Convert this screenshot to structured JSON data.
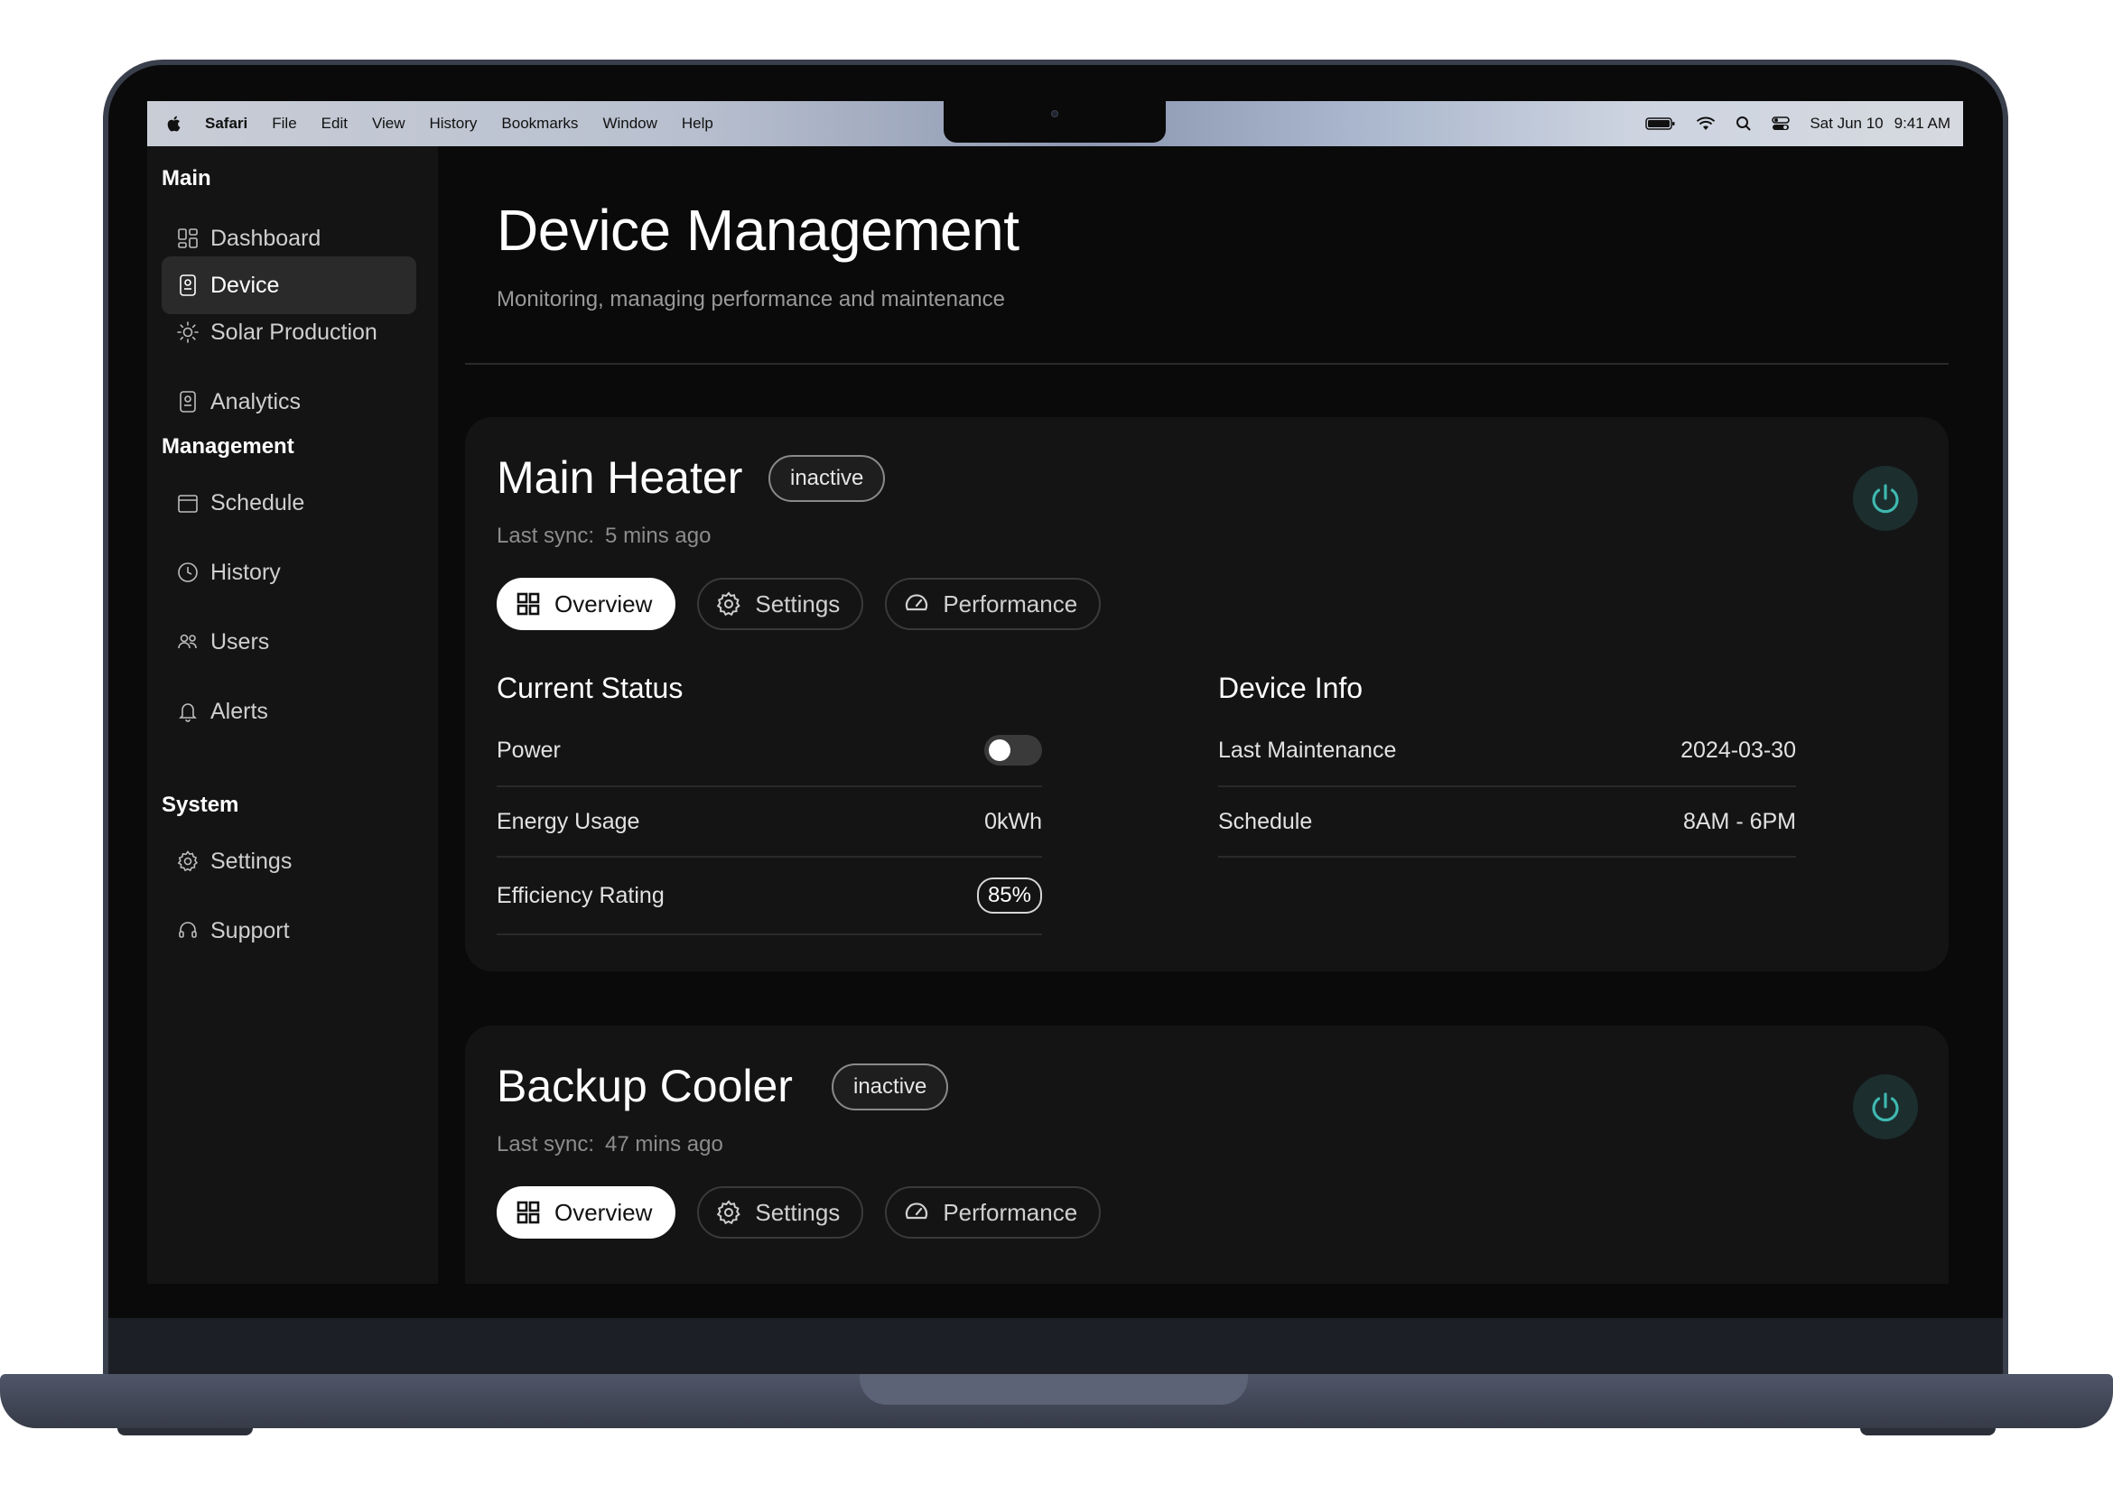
{
  "menubar": {
    "app_name": "Safari",
    "menus": [
      "File",
      "Edit",
      "View",
      "History",
      "Bookmarks",
      "Window",
      "Help"
    ],
    "date": "Sat Jun 10",
    "time": "9:41 AM"
  },
  "sidebar": {
    "sections": [
      {
        "title": "Main",
        "items": [
          {
            "label": "Dashboard",
            "icon": "dashboard-icon"
          },
          {
            "label": "Device",
            "icon": "device-icon",
            "active": true
          },
          {
            "label": "Solar Production",
            "icon": "sun-icon"
          },
          {
            "label": "Analytics",
            "icon": "analytics-icon"
          }
        ]
      },
      {
        "title": "Management",
        "items": [
          {
            "label": "Schedule",
            "icon": "calendar-icon"
          },
          {
            "label": "History",
            "icon": "clock-icon"
          },
          {
            "label": "Users",
            "icon": "users-icon"
          },
          {
            "label": "Alerts",
            "icon": "bell-icon"
          }
        ]
      },
      {
        "title": "System",
        "items": [
          {
            "label": "Settings",
            "icon": "gear-icon"
          },
          {
            "label": "Support",
            "icon": "headset-icon"
          }
        ]
      }
    ]
  },
  "page": {
    "title": "Device Management",
    "subtitle": "Monitoring, managing performance and maintenance"
  },
  "tabs": [
    "Overview",
    "Settings",
    "Performance"
  ],
  "devices": [
    {
      "name": "Main Heater",
      "status": "inactive",
      "sync_label": "Last sync:",
      "sync_value": "5 mins ago",
      "current_status": {
        "title": "Current Status",
        "power_label": "Power",
        "power_on": false,
        "energy_label": "Energy Usage",
        "energy_value": "0kWh",
        "efficiency_label": "Efficiency Rating",
        "efficiency_value": "85%"
      },
      "device_info": {
        "title": "Device Info",
        "maintenance_label": "Last Maintenance",
        "maintenance_value": "2024-03-30",
        "schedule_label": "Schedule",
        "schedule_value": "8AM - 6PM"
      }
    },
    {
      "name": "Backup Cooler",
      "status": "inactive",
      "sync_label": "Last sync:",
      "sync_value": "47 mins ago"
    }
  ],
  "colors": {
    "accent": "#3fb8b0",
    "background": "#0a0a0a",
    "card": "#141414"
  }
}
